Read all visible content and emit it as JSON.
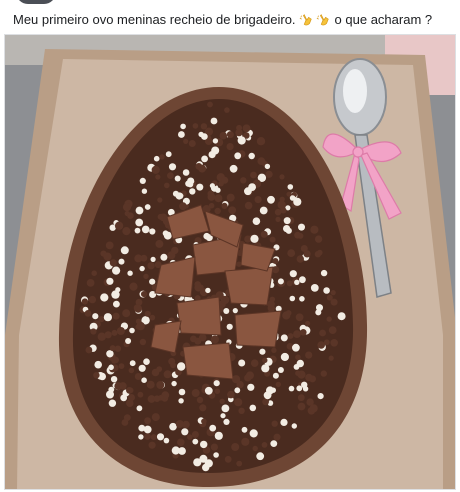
{
  "post": {
    "caption_text": "Meu primeiro ovo meninas recheio de brigadeiro.",
    "caption_emojis": [
      "clapping-hands-emoji",
      "clapping-hands-emoji"
    ],
    "caption_suffix": "o que acharam ?"
  },
  "photo": {
    "subject_icon": "chocolate-easter-egg-photo",
    "colors": {
      "table": "#8d8f93",
      "box": "#c9b19a",
      "board": "#cdb7a4",
      "chocolate_shell": "#6e4634",
      "sprinkle_dark": "#5a3527",
      "sprinkle_light": "#f2ece3",
      "ribbon": "#f2a3c7",
      "spoon": "#c6c9cd"
    }
  }
}
